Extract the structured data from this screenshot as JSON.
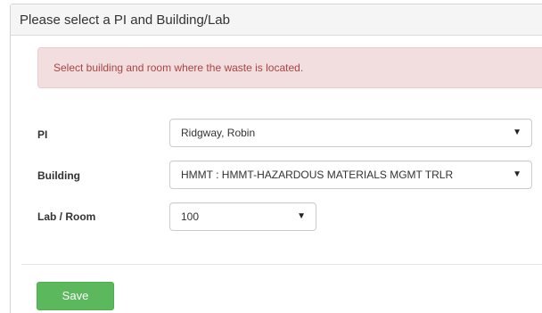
{
  "panel": {
    "title": "Please select a PI and Building/Lab"
  },
  "alert": {
    "message": "Select building and room where the waste is located.",
    "color": "#a94442",
    "background": "#f2dede"
  },
  "form": {
    "pi": {
      "label": "PI",
      "selected": "Ridgway, Robin"
    },
    "building": {
      "label": "Building",
      "selected": "HMMT : HMMT-HAZARDOUS MATERIALS MGMT TRLR"
    },
    "room": {
      "label": "Lab / Room",
      "selected": "100"
    }
  },
  "icons": {
    "dropdown": "caret-down-icon",
    "caret_glyph": "▼"
  },
  "actions": {
    "save_label": "Save",
    "save_color": "#5cb85c"
  }
}
